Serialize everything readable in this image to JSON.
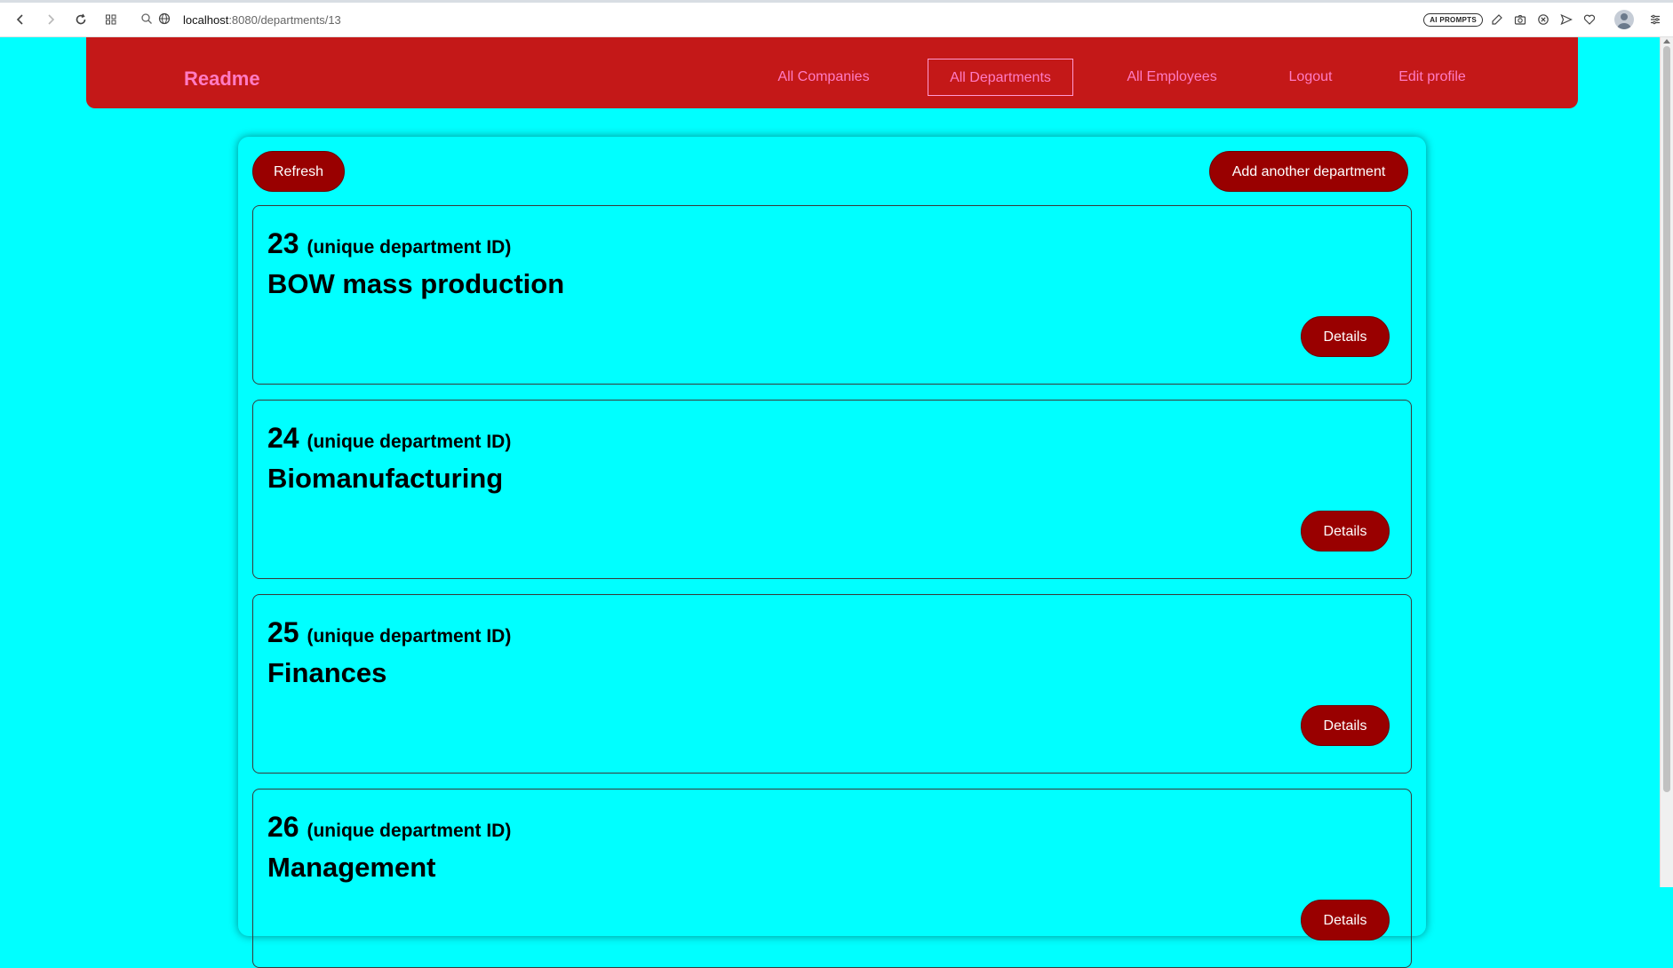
{
  "browser": {
    "url_host": "localhost",
    "url_path": ":8080/departments/13",
    "ai_prompts_label": "AI PROMPTS"
  },
  "navbar": {
    "brand": "Readme",
    "links": [
      {
        "label": "All Companies",
        "active": false
      },
      {
        "label": "All Departments",
        "active": true
      },
      {
        "label": "All Employees",
        "active": false
      },
      {
        "label": "Logout",
        "active": false
      },
      {
        "label": "Edit profile",
        "active": false
      }
    ]
  },
  "toolbar": {
    "refresh_label": "Refresh",
    "add_label": "Add another department"
  },
  "departments": [
    {
      "id": "23",
      "id_note": "(unique department ID)",
      "name": "BOW mass production",
      "details_label": "Details"
    },
    {
      "id": "24",
      "id_note": "(unique department ID)",
      "name": "Biomanufacturing",
      "details_label": "Details"
    },
    {
      "id": "25",
      "id_note": "(unique department ID)",
      "name": "Finances",
      "details_label": "Details"
    },
    {
      "id": "26",
      "id_note": "(unique department ID)",
      "name": "Management",
      "details_label": "Details"
    }
  ],
  "colors": {
    "page_bg": "#00ffff",
    "navbar_bg": "#c41818",
    "nav_text": "#ff7bc3",
    "button_bg": "#990000"
  }
}
